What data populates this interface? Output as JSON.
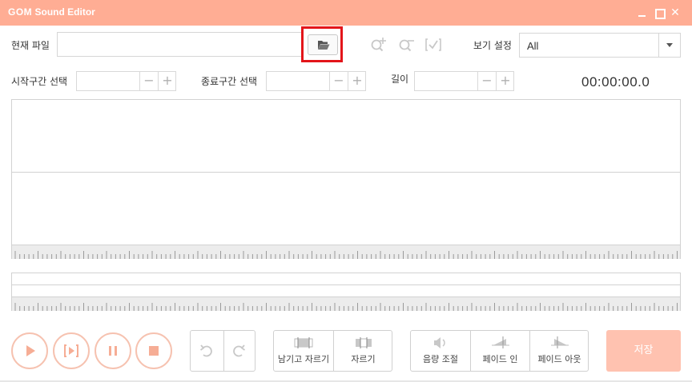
{
  "window": {
    "title_brand": "GOM",
    "title_rest": " Sound Editor"
  },
  "toolbar": {
    "current_file_label": "현재 파일",
    "current_file_value": "",
    "view_settings_label": "보기 설정",
    "view_settings_value": "All"
  },
  "selection": {
    "start_label": "시작구간 선택",
    "end_label": "종료구간 선택",
    "length_label": "길이",
    "start_value": "",
    "end_value": "",
    "length_value": "",
    "minus": "−",
    "plus": "+",
    "time_display": "00:00:00.0"
  },
  "edit_buttons": {
    "keep_and_cut": "남기고 자르기",
    "cut": "자르기"
  },
  "effect_buttons": {
    "volume": "음량 조절",
    "fade_in": "페이드 인",
    "fade_out": "페이드 아웃"
  },
  "save_label": "저장",
  "icons": {
    "close": "✕",
    "open_folder": "folder-open-icon",
    "zoom_in": "zoom-in-icon",
    "zoom_out": "zoom-out-icon",
    "zoom_fit": "zoom-fit-icon",
    "play": "play-icon",
    "play_selection": "play-selection-icon",
    "pause": "pause-icon",
    "stop": "stop-icon",
    "undo": "undo-icon",
    "redo": "redo-icon"
  },
  "colors": {
    "accent": "#ffad94",
    "accent_light": "#f6c2b0",
    "save_button": "#ffc2b0",
    "highlight": "#e3151a"
  }
}
